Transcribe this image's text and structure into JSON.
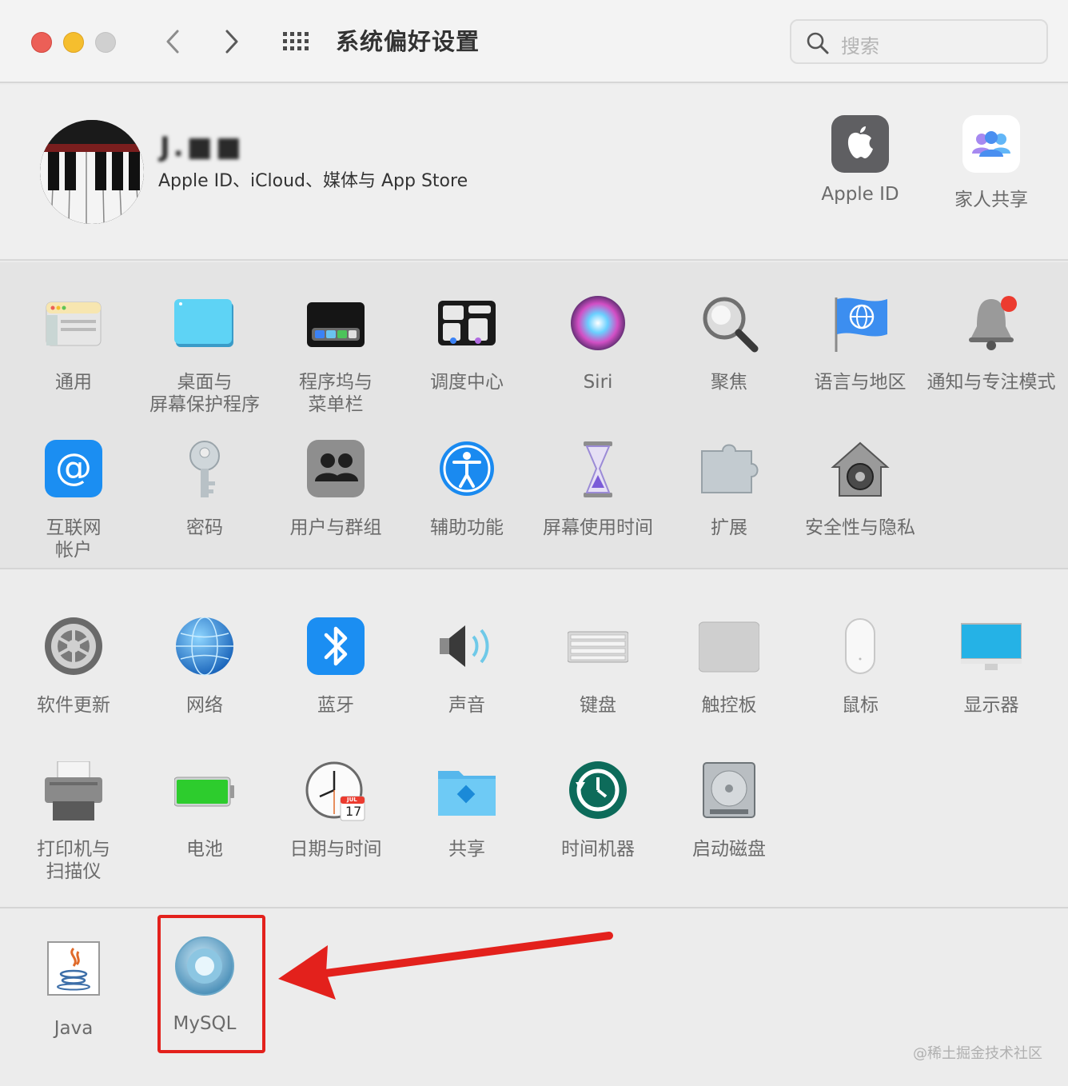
{
  "window": {
    "title": "系统偏好设置",
    "search_placeholder": "搜索"
  },
  "account": {
    "name": "J.■■",
    "subtitle": "Apple ID、iCloud、媒体与 App Store",
    "apps": [
      {
        "label": "Apple ID",
        "icon": "apple-id-icon"
      },
      {
        "label": "家人共享",
        "icon": "family-sharing-icon"
      }
    ]
  },
  "section1": [
    {
      "label": "通用",
      "icon": "general-icon"
    },
    {
      "label": "桌面与\n屏幕保护程序",
      "icon": "desktop-screensaver-icon"
    },
    {
      "label": "程序坞与\n菜单栏",
      "icon": "dock-menubar-icon"
    },
    {
      "label": "调度中心",
      "icon": "mission-control-icon"
    },
    {
      "label": "Siri",
      "icon": "siri-icon"
    },
    {
      "label": "聚焦",
      "icon": "spotlight-icon"
    },
    {
      "label": "语言与地区",
      "icon": "language-region-icon"
    },
    {
      "label": "通知与专注模式",
      "icon": "notifications-icon"
    },
    {
      "label": "互联网\n帐户",
      "icon": "internet-accounts-icon"
    },
    {
      "label": "密码",
      "icon": "passwords-icon"
    },
    {
      "label": "用户与群组",
      "icon": "users-groups-icon"
    },
    {
      "label": "辅助功能",
      "icon": "accessibility-icon"
    },
    {
      "label": "屏幕使用时间",
      "icon": "screen-time-icon"
    },
    {
      "label": "扩展",
      "icon": "extensions-icon"
    },
    {
      "label": "安全性与隐私",
      "icon": "security-privacy-icon"
    }
  ],
  "section2": [
    {
      "label": "软件更新",
      "icon": "software-update-icon"
    },
    {
      "label": "网络",
      "icon": "network-icon"
    },
    {
      "label": "蓝牙",
      "icon": "bluetooth-icon"
    },
    {
      "label": "声音",
      "icon": "sound-icon"
    },
    {
      "label": "键盘",
      "icon": "keyboard-icon"
    },
    {
      "label": "触控板",
      "icon": "trackpad-icon"
    },
    {
      "label": "鼠标",
      "icon": "mouse-icon"
    },
    {
      "label": "显示器",
      "icon": "displays-icon"
    },
    {
      "label": "打印机与\n扫描仪",
      "icon": "printers-scanners-icon"
    },
    {
      "label": "电池",
      "icon": "battery-icon"
    },
    {
      "label": "日期与时间",
      "icon": "date-time-icon"
    },
    {
      "label": "共享",
      "icon": "sharing-icon"
    },
    {
      "label": "时间机器",
      "icon": "time-machine-icon"
    },
    {
      "label": "启动磁盘",
      "icon": "startup-disk-icon"
    }
  ],
  "section3": [
    {
      "label": "Java",
      "icon": "java-icon"
    },
    {
      "label": "MySQL",
      "icon": "mysql-icon"
    }
  ],
  "date_icon": {
    "month": "JUL",
    "day": "17"
  },
  "annotation": {
    "color": "#e3211c",
    "target": "MySQL"
  },
  "watermark": "@稀土掘金技术社区"
}
